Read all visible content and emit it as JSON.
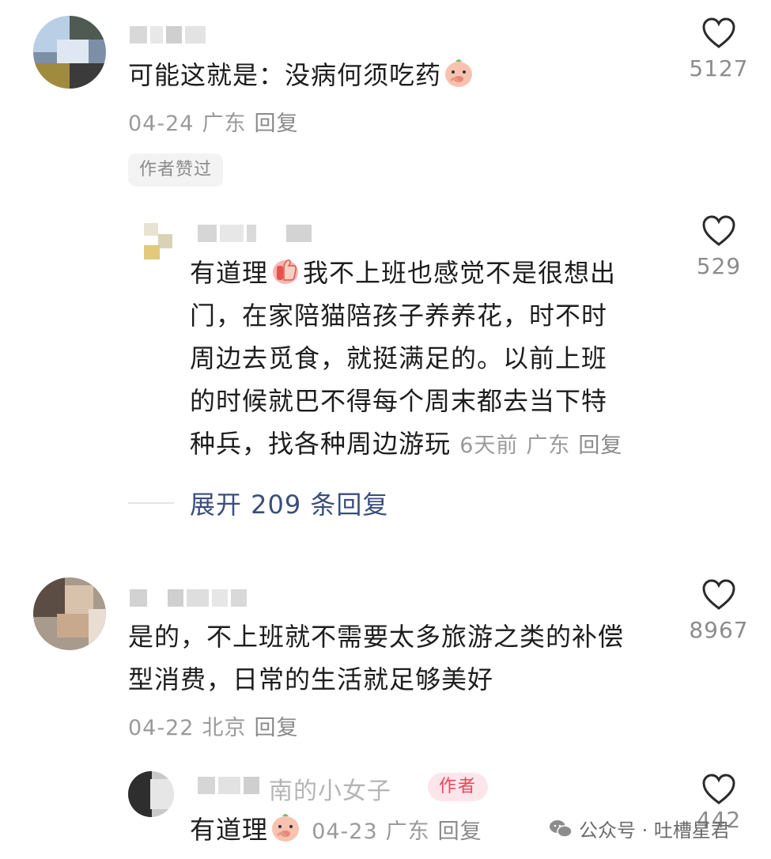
{
  "comments": [
    {
      "text": "可能这就是：没病何须吃药",
      "emoji": "laugh-cover-mouth-emoji",
      "date": "04-24",
      "location": "广东",
      "reply_label": "回复",
      "likes": "5127",
      "badge": "作者赞过",
      "replies": [
        {
          "line1": "有道理",
          "line1b": "我不上班也感觉不是很想出",
          "line2": "门，在家陪猫陪孩子养养花，时不时",
          "line3": "周边去觅食，就挺满足的。以前上班",
          "line4": "的时候就巴不得每个周末都去当下特",
          "line5": "种兵，找各种周边游玩",
          "date": "6天前",
          "location": "广东",
          "reply_label": "回复",
          "likes": "529"
        }
      ],
      "expand_label": "展开 209 条回复"
    },
    {
      "line1": "是的，不上班就不需要太多旅游之类的补偿",
      "line2": "型消费，日常的生活就足够美好",
      "date": "04-22",
      "location": "北京",
      "reply_label": "回复",
      "likes": "8967",
      "replies": [
        {
          "name_partial": "南的小女子",
          "author_badge": "作者",
          "text": "有道理",
          "date": "04-23",
          "location": "广东",
          "reply_label": "回复",
          "likes": "442"
        }
      ]
    }
  ],
  "watermark": {
    "text": "公众号 · 吐槽星君",
    "icon": "wechat-icon"
  },
  "colors": {
    "meta_gray": "#9a9a9a",
    "link_blue": "#3a4e7c",
    "author_red": "#f0445a"
  }
}
